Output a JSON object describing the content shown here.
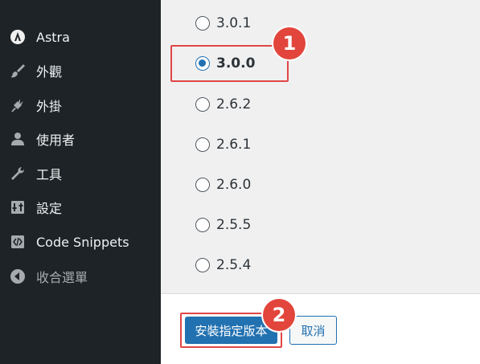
{
  "sidebar": {
    "items": [
      {
        "label": "Astra",
        "icon": "astra-logo-icon"
      },
      {
        "label": "外觀",
        "icon": "paintbrush-icon"
      },
      {
        "label": "外掛",
        "icon": "plugin-icon"
      },
      {
        "label": "使用者",
        "icon": "user-icon"
      },
      {
        "label": "工具",
        "icon": "wrench-icon"
      },
      {
        "label": "設定",
        "icon": "settings-sliders-icon"
      },
      {
        "label": "Code Snippets",
        "icon": "code-icon"
      },
      {
        "label": "收合選單",
        "icon": "collapse-arrow-icon"
      }
    ]
  },
  "versions": {
    "options": [
      "3.0.1",
      "3.0.0",
      "2.6.2",
      "2.6.1",
      "2.6.0",
      "2.5.5",
      "2.5.4"
    ],
    "selected": "3.0.0"
  },
  "annotations": {
    "step1": "1",
    "step2": "2"
  },
  "actions": {
    "install_label": "安裝指定版本",
    "cancel_label": "取消"
  },
  "colors": {
    "sidebar_bg": "#1d2327",
    "primary": "#2271b1",
    "annotation_red": "#e2453b"
  }
}
